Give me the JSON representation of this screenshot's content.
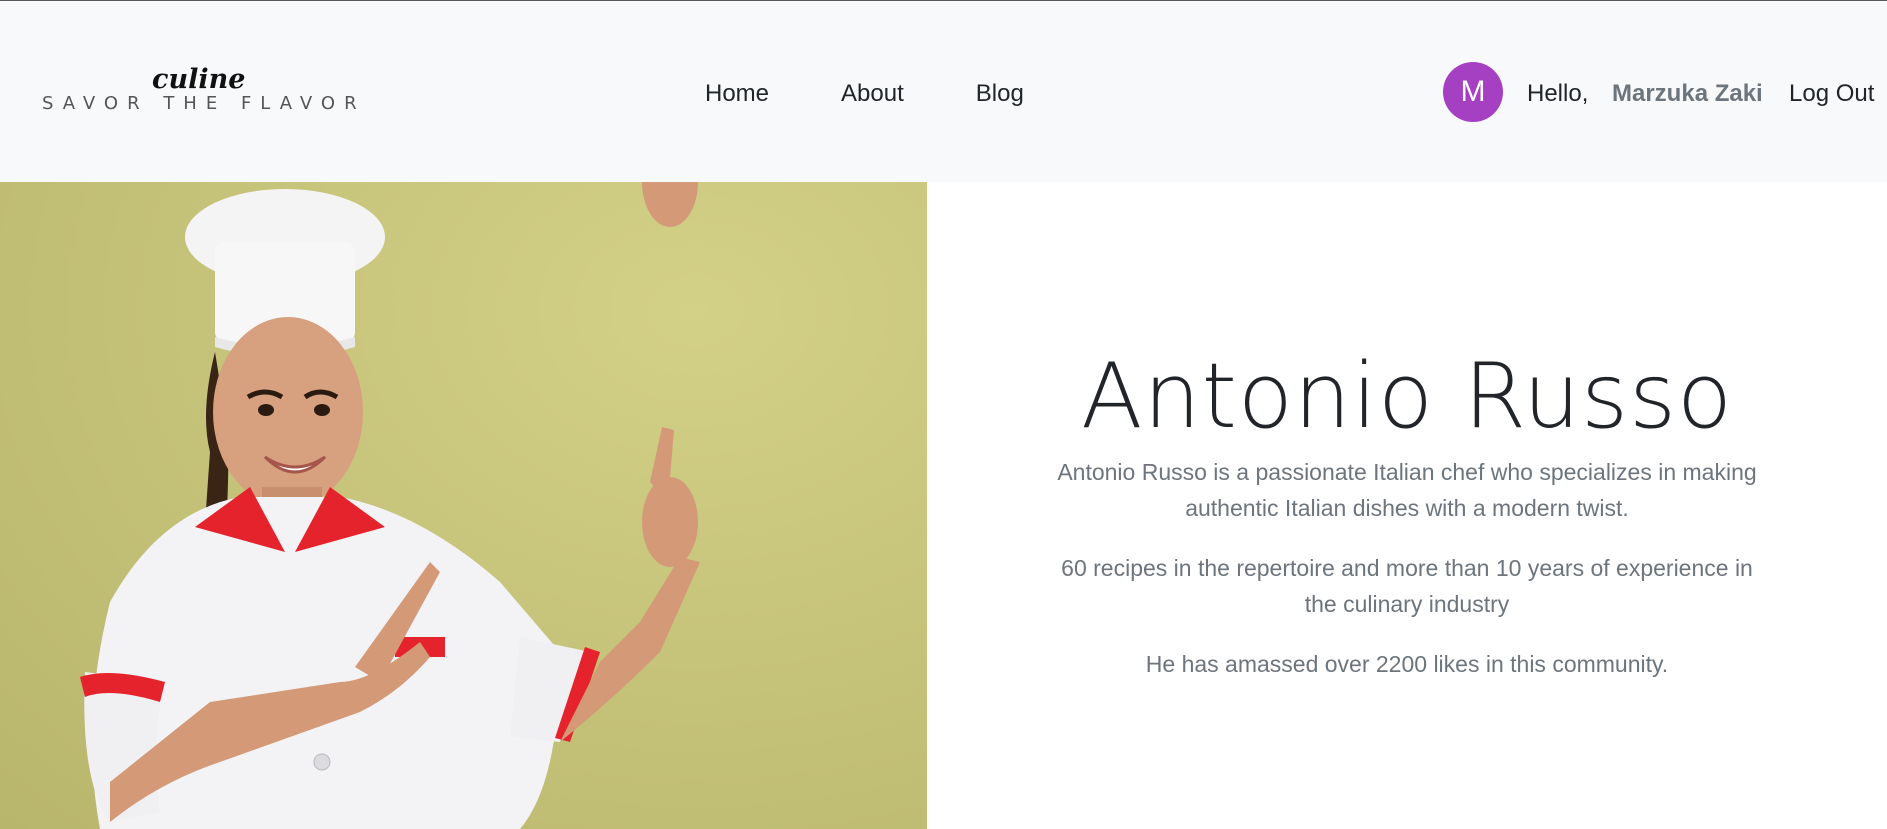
{
  "navbar": {
    "logo_script": "culine",
    "logo_tagline": "SAVOR THE FLAVOR",
    "links": [
      "Home",
      "About",
      "Blog"
    ],
    "avatar_initial": "M",
    "avatar_color": "#a640c2",
    "greeting": "Hello,",
    "username": "Marzuka Zaki",
    "logout": "Log Out"
  },
  "hero": {
    "image_background": "#c8c57c",
    "name": "Antonio Russo",
    "description": "Antonio Russo is a passionate Italian chef who specializes in making authentic Italian dishes with a modern twist.",
    "stats": "60 recipes in the repertoire and more than 10 years of experience in the culinary industry",
    "likes": "He has amassed over 2200 likes in this community."
  }
}
